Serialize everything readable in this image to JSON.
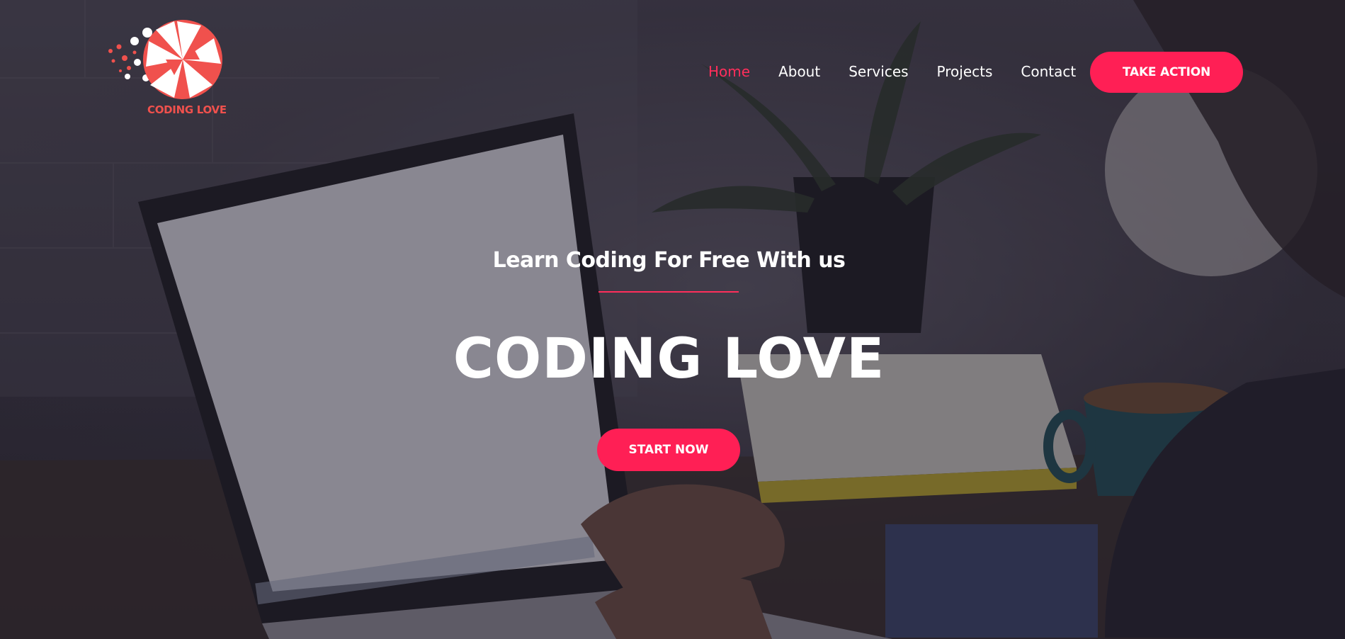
{
  "brand": {
    "logo_text": "CODING LOVE",
    "accent_color": "#ff1f55",
    "logo_color": "#f0514d"
  },
  "nav": {
    "items": [
      {
        "label": "Home",
        "active": true
      },
      {
        "label": "About",
        "active": false
      },
      {
        "label": "Services",
        "active": false
      },
      {
        "label": "Projects",
        "active": false
      },
      {
        "label": "Contact",
        "active": false
      }
    ],
    "cta_label": "TAKE ACTION"
  },
  "hero": {
    "tagline": "Learn Coding For Free With us",
    "headline": "CODING LOVE",
    "button_label": "START NOW",
    "background": "photo-laptop-desk"
  }
}
